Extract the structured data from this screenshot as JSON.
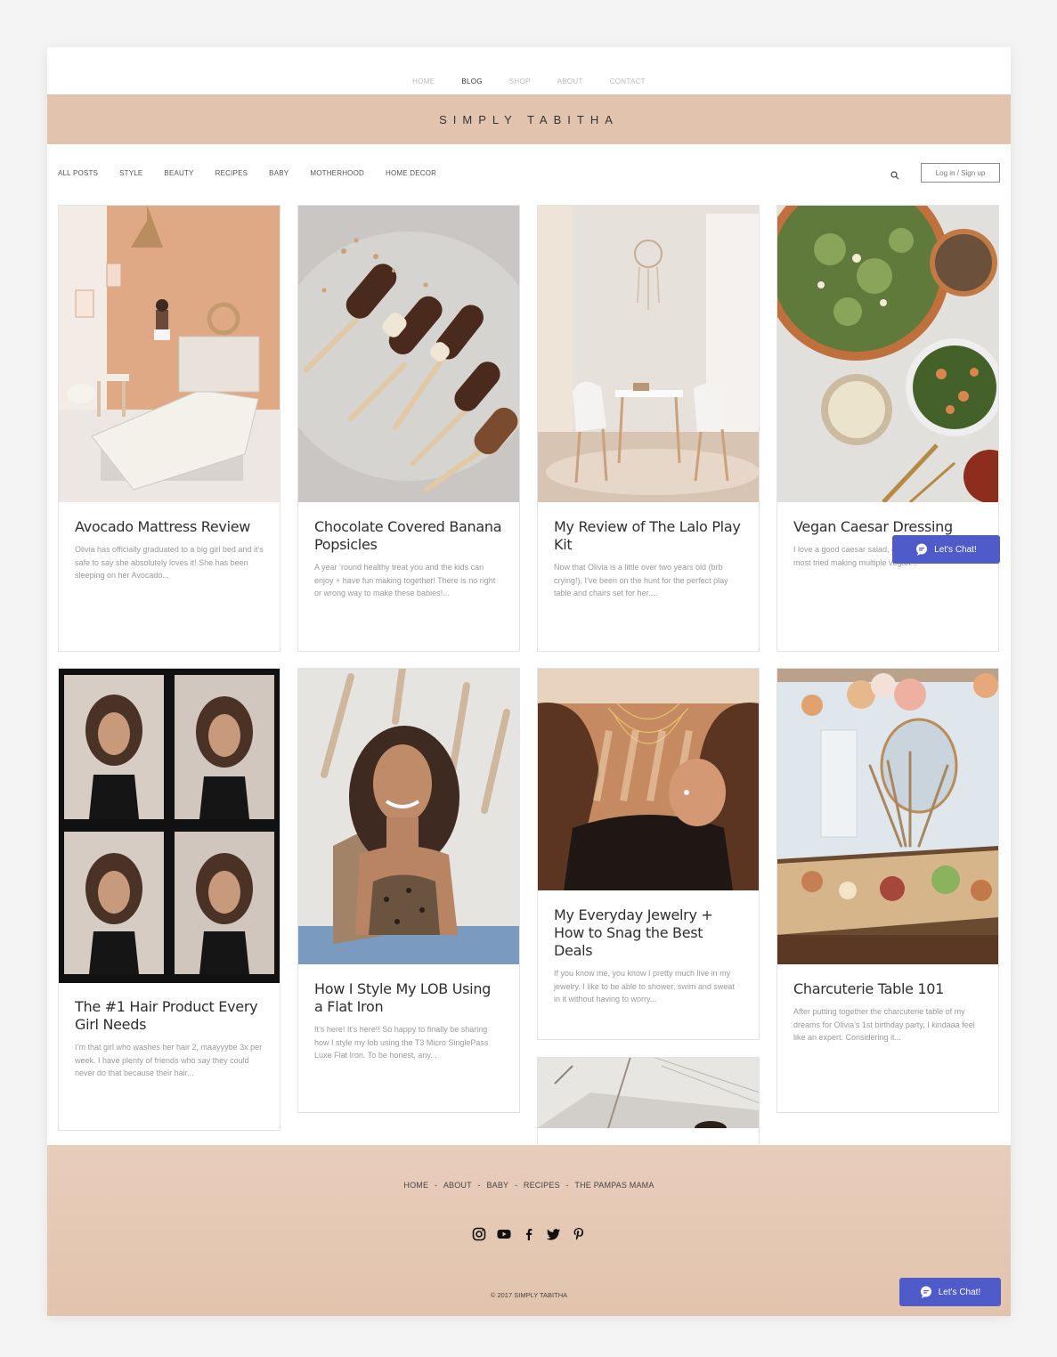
{
  "topnav": {
    "items": [
      {
        "label": "HOME"
      },
      {
        "label": "BLOG"
      },
      {
        "label": "SHOP"
      },
      {
        "label": "ABOUT"
      },
      {
        "label": "CONTACT"
      }
    ]
  },
  "banner": {
    "title": "SIMPLY TABITHA"
  },
  "categories": {
    "items": [
      {
        "label": "ALL POSTS"
      },
      {
        "label": "STYLE"
      },
      {
        "label": "BEAUTY"
      },
      {
        "label": "RECIPES"
      },
      {
        "label": "BABY"
      },
      {
        "label": "MOTHERHOOD"
      },
      {
        "label": "HOME DECOR"
      }
    ]
  },
  "login": {
    "label": "Log in / Sign up"
  },
  "posts": [
    {
      "title": "Avocado Mattress Review",
      "excerpt": "Olivia has officially graduated to a big girl bed and it’s safe to say she absolutely loves it! She has been sleeping on her Avocado..."
    },
    {
      "title": "Chocolate Covered Banana Popsicles",
      "excerpt": "A year ‘round healthy treat you and the kids can enjoy + have fun making together! There is no right or wrong way to make these babies!..."
    },
    {
      "title": "My Review of The Lalo Play Kit",
      "excerpt": "Now that Olivia is a little over two years old (brb crying!), I’ve been on the hunt for the perfect play table and chairs set for her...."
    },
    {
      "title": "Vegan Caesar Dressing",
      "excerpt": "I love a good caesar salad, dairy that comes with most tried making multiple vegan..."
    },
    {
      "title": "The #1 Hair Product Every Girl Needs",
      "excerpt": "I’m that girl who washes her hair 2, maayyybe 3x per week. I have plenty of friends who say they could never do that because their hair..."
    },
    {
      "title": "How I Style My LOB Using a Flat Iron",
      "excerpt": "It’s here! It’s here!! So happy to finally be sharing how I style my lob using the T3 Micro SinglePass Luxe Flat Iron. To be honest, any..."
    },
    {
      "title": "My Everyday Jewelry + How to Snag the Best Deals",
      "excerpt": "If you know me, you know I pretty much live in my jewelry. I like to be able to shower, swim and sweat in it without having to worry..."
    },
    {
      "title": "Charcuterie Table 101",
      "excerpt": "After putting together the charcuterie table of my dreams for Olivia’s 1st birthday party, I kindaaa feel like an expert. Considering it..."
    }
  ],
  "footer": {
    "links": [
      {
        "label": "HOME"
      },
      {
        "label": "ABOUT"
      },
      {
        "label": "BABY"
      },
      {
        "label": "RECIPES"
      },
      {
        "label": "THE PAMPAS MAMA"
      }
    ],
    "separator": "-",
    "social": [
      "instagram-icon",
      "youtube-icon",
      "facebook-icon",
      "twitter-icon",
      "pinterest-icon"
    ],
    "copyright": "© 2017 SIMPLY TABITHA"
  },
  "chat": {
    "label": "Let's Chat!"
  },
  "colors": {
    "banner": "#e2c4ae",
    "chat": "#4e5bc9"
  }
}
